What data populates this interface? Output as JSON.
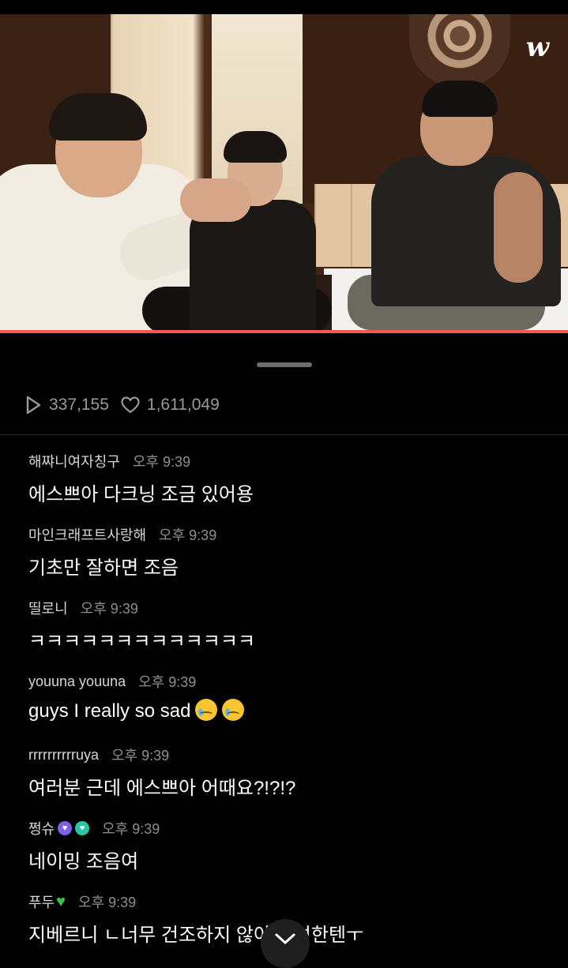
{
  "app": {
    "logo_text": "w"
  },
  "video": {
    "progress_fraction": 1.0
  },
  "stats": {
    "views": "337,155",
    "likes": "1,611,049"
  },
  "colors": {
    "accent": "#f25a5a",
    "background": "#000000",
    "muted": "#9a9a9a"
  },
  "comments": [
    {
      "user": "해쨔니여자칭구",
      "time": "오후 9:39",
      "text": "에스쁘아 다크닝 조금 있어용"
    },
    {
      "user": "마인크래프트사랑해",
      "time": "오후 9:39",
      "text": "기초만 잘하면 조음"
    },
    {
      "user": "띨로니",
      "time": "오후 9:39",
      "text": "ㅋㅋㅋㅋㅋㅋㅋㅋㅋㅋㅋㅋㅋ"
    },
    {
      "user": "youuna youuna",
      "time": "오후 9:39",
      "text": "guys I really so sad"
    },
    {
      "user": "rrrrrrrrrruya",
      "time": "오후 9:39",
      "text": "여러분 근데 에스쁘아 어때요?!?!?"
    },
    {
      "user": "쩡슈",
      "time": "오후 9:39",
      "text": "네이밍 조음여"
    },
    {
      "user": "푸두",
      "time": "오후 9:39",
      "text": "지베르니 ㄴ너무 건조하지 않아 건성한텐ㅜ"
    }
  ],
  "icons": {
    "views": "play-icon",
    "likes": "heart-outline-icon",
    "collapse": "chevron-down-icon"
  }
}
